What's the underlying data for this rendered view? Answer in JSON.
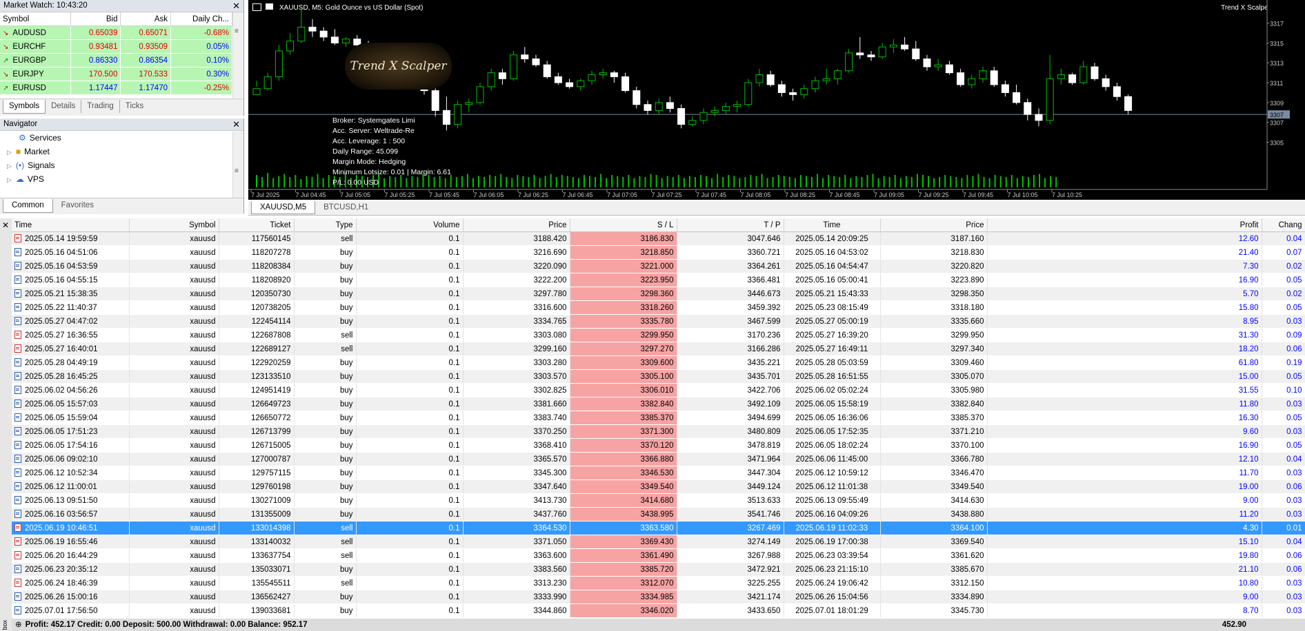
{
  "market_watch": {
    "title": "Market Watch: 10:43:20",
    "headers": [
      "Symbol",
      "Bid",
      "Ask",
      "Daily Ch..."
    ],
    "rows": [
      {
        "symbol": "AUDUSD",
        "bid": "0.65039",
        "ask": "0.65071",
        "change": "-0.68%",
        "dir": "down"
      },
      {
        "symbol": "EURCHF",
        "bid": "0.93481",
        "ask": "0.93509",
        "change": "0.05%",
        "dir": "down"
      },
      {
        "symbol": "EURGBP",
        "bid": "0.86330",
        "ask": "0.86354",
        "change": "0.10%",
        "dir": "up"
      },
      {
        "symbol": "EURJPY",
        "bid": "170.500",
        "ask": "170.533",
        "change": "0.30%",
        "dir": "down"
      },
      {
        "symbol": "EURUSD",
        "bid": "1.17447",
        "ask": "1.17470",
        "change": "-0.25%",
        "dir": "up"
      }
    ],
    "tabs": [
      "Symbols",
      "Details",
      "Trading",
      "Ticks"
    ]
  },
  "navigator": {
    "title": "Navigator",
    "items": [
      "Services",
      "Market",
      "Signals",
      "VPS"
    ],
    "tabs": [
      "Common",
      "Favorites"
    ]
  },
  "chart": {
    "title": "XAUUSD, M5:  Gold Ounce vs US Dollar (Spot)",
    "brand": "Trend X Scalper",
    "logo_text": "Trend X Scalper",
    "info": [
      "Broker:  Systemgates Limi",
      "Acc. Server:  Weltrade-Re",
      "Acc. Leverage:  1 : 500",
      "Daily Range:  45.099",
      "Margin Mode:  Hedging",
      "Minimum Lotsize: 0.01 | Margin: 6.61",
      "P/L: 0.00 USD"
    ],
    "price_labels": [
      "3317",
      "3315",
      "3313",
      "3311",
      "3309",
      "3307",
      "3305"
    ],
    "current_price_label": "3307",
    "time_labels": [
      "7 Jul 2025",
      "7 Jul 04:45",
      "7 Jul 05:05",
      "7 Jul 05:25",
      "7 Jul 05:45",
      "7 Jul 06:05",
      "7 Jul 06:25",
      "7 Jul 06:45",
      "7 Jul 07:05",
      "7 Jul 07:25",
      "7 Jul 07:45",
      "7 Jul 08:05",
      "7 Jul 08:25",
      "7 Jul 08:45",
      "7 Jul 09:05",
      "7 Jul 09:25",
      "7 Jul 09:45",
      "7 Jul 10:05",
      "7 Jul 10:25"
    ],
    "candles": [
      [
        3309.8,
        3311.2,
        3310.6,
        3310.4
      ],
      [
        3310.4,
        3312.0,
        3310.2,
        3311.6
      ],
      [
        3311.6,
        3314.8,
        3311.2,
        3314.2
      ],
      [
        3314.2,
        3316.0,
        3313.8,
        3315.2
      ],
      [
        3315.2,
        3318.6,
        3315.0,
        3316.6
      ],
      [
        3316.6,
        3317.4,
        3315.6,
        3316.2
      ],
      [
        3316.2,
        3316.6,
        3315.2,
        3315.6
      ],
      [
        3315.6,
        3316.4,
        3314.8,
        3315.0
      ],
      [
        3315.0,
        3315.6,
        3314.6,
        3315.4
      ],
      [
        3315.4,
        3315.8,
        3314.4,
        3314.8
      ],
      [
        3314.8,
        3315.2,
        3313.6,
        3313.8
      ],
      [
        3313.8,
        3314.4,
        3313.0,
        3313.4
      ],
      [
        3313.4,
        3313.8,
        3312.6,
        3312.8
      ],
      [
        3312.8,
        3313.0,
        3311.6,
        3311.8
      ],
      [
        3311.8,
        3312.4,
        3311.0,
        3311.4
      ],
      [
        3311.4,
        3311.8,
        3309.8,
        3310.2
      ],
      [
        3310.2,
        3310.6,
        3307.6,
        3308.2
      ],
      [
        3308.2,
        3309.6,
        3306.2,
        3306.8
      ],
      [
        3306.8,
        3309.2,
        3306.4,
        3308.8
      ],
      [
        3308.8,
        3309.4,
        3308.0,
        3309.0
      ],
      [
        3309.0,
        3311.0,
        3308.8,
        3310.6
      ],
      [
        3310.6,
        3312.4,
        3310.2,
        3312.0
      ],
      [
        3312.0,
        3312.4,
        3310.8,
        3311.4
      ],
      [
        3311.4,
        3314.2,
        3311.2,
        3313.8
      ],
      [
        3313.8,
        3314.6,
        3313.0,
        3313.4
      ],
      [
        3313.4,
        3313.8,
        3312.6,
        3312.8
      ],
      [
        3312.8,
        3313.2,
        3311.4,
        3311.6
      ],
      [
        3311.6,
        3312.0,
        3310.8,
        3311.0
      ],
      [
        3311.0,
        3311.4,
        3310.4,
        3310.6
      ],
      [
        3310.6,
        3311.4,
        3310.2,
        3311.2
      ],
      [
        3311.2,
        3312.2,
        3310.8,
        3311.8
      ],
      [
        3311.8,
        3312.4,
        3311.4,
        3312.0
      ],
      [
        3312.0,
        3312.2,
        3311.0,
        3311.6
      ],
      [
        3311.6,
        3312.0,
        3310.0,
        3310.2
      ],
      [
        3310.2,
        3310.6,
        3308.4,
        3308.8
      ],
      [
        3308.8,
        3309.2,
        3307.8,
        3308.2
      ],
      [
        3308.2,
        3309.4,
        3307.8,
        3309.0
      ],
      [
        3309.0,
        3309.6,
        3308.0,
        3308.4
      ],
      [
        3308.4,
        3308.8,
        3306.4,
        3306.8
      ],
      [
        3306.8,
        3307.6,
        3306.6,
        3307.2
      ],
      [
        3307.2,
        3308.4,
        3306.8,
        3308.0
      ],
      [
        3308.0,
        3308.6,
        3307.6,
        3308.2
      ],
      [
        3308.2,
        3309.0,
        3307.8,
        3308.6
      ],
      [
        3308.6,
        3309.2,
        3308.0,
        3308.8
      ],
      [
        3308.8,
        3311.4,
        3308.6,
        3311.0
      ],
      [
        3311.0,
        3312.4,
        3310.6,
        3311.8
      ],
      [
        3311.8,
        3312.2,
        3310.6,
        3310.8
      ],
      [
        3310.8,
        3311.2,
        3309.6,
        3310.0
      ],
      [
        3310.0,
        3310.4,
        3309.2,
        3309.8
      ],
      [
        3309.8,
        3310.8,
        3309.4,
        3310.4
      ],
      [
        3310.4,
        3311.6,
        3310.0,
        3311.2
      ],
      [
        3311.2,
        3312.4,
        3310.8,
        3311.4
      ],
      [
        3311.4,
        3312.4,
        3310.8,
        3312.2
      ],
      [
        3312.2,
        3314.4,
        3312.0,
        3314.0
      ],
      [
        3314.0,
        3315.6,
        3313.4,
        3313.8
      ],
      [
        3313.8,
        3314.2,
        3313.2,
        3313.6
      ],
      [
        3313.6,
        3315.0,
        3313.4,
        3314.6
      ],
      [
        3314.6,
        3315.4,
        3314.0,
        3314.8
      ],
      [
        3314.8,
        3315.6,
        3314.2,
        3314.4
      ],
      [
        3314.4,
        3315.2,
        3313.2,
        3313.4
      ],
      [
        3313.4,
        3313.8,
        3312.2,
        3312.6
      ],
      [
        3312.6,
        3313.4,
        3312.2,
        3312.8
      ],
      [
        3312.8,
        3313.2,
        3311.8,
        3312.0
      ],
      [
        3312.0,
        3312.4,
        3310.6,
        3310.8
      ],
      [
        3310.8,
        3311.8,
        3310.4,
        3311.4
      ],
      [
        3311.4,
        3312.6,
        3311.0,
        3312.2
      ],
      [
        3312.2,
        3312.6,
        3310.6,
        3310.8
      ],
      [
        3310.8,
        3311.2,
        3309.6,
        3310.0
      ],
      [
        3310.0,
        3310.8,
        3308.8,
        3309.0
      ],
      [
        3309.0,
        3309.4,
        3307.2,
        3307.8
      ],
      [
        3307.8,
        3308.4,
        3306.6,
        3307.2
      ],
      [
        3307.2,
        3313.8,
        3306.8,
        3311.4
      ],
      [
        3311.4,
        3312.4,
        3310.8,
        3311.8
      ],
      [
        3311.8,
        3312.0,
        3310.8,
        3311.0
      ],
      [
        3311.0,
        3313.2,
        3310.8,
        3312.6
      ],
      [
        3312.6,
        3313.0,
        3311.2,
        3311.4
      ],
      [
        3311.4,
        3311.8,
        3310.2,
        3310.6
      ],
      [
        3310.6,
        3311.0,
        3309.2,
        3309.6
      ],
      [
        3309.6,
        3309.8,
        3307.8,
        3308.2
      ]
    ],
    "volumes": [
      12,
      10,
      14,
      9,
      11,
      13,
      10,
      12,
      8,
      11,
      10,
      13,
      9,
      12,
      11,
      10,
      14,
      9,
      12,
      11,
      10,
      12,
      13,
      9,
      11,
      10,
      12,
      9,
      11,
      10,
      13,
      12,
      10,
      11,
      9,
      12,
      10,
      11,
      13,
      9,
      11,
      10,
      12,
      11,
      13,
      10,
      9,
      12,
      11,
      10,
      12,
      9,
      11,
      13,
      10,
      12,
      11,
      10,
      9,
      12,
      11,
      10,
      13,
      9,
      12,
      11,
      10,
      12,
      9,
      11,
      10,
      13,
      12,
      9,
      11,
      10,
      12,
      9,
      11,
      10,
      12,
      11,
      9,
      13,
      10,
      12,
      11,
      9,
      10,
      12,
      11,
      13,
      9,
      10,
      12,
      11,
      10,
      9,
      12,
      11,
      10,
      13,
      9,
      12,
      11,
      10,
      12,
      9,
      11,
      10,
      12,
      13,
      9,
      11,
      10,
      12,
      9,
      11,
      10,
      13,
      12,
      11,
      9,
      10,
      12,
      11,
      10,
      9,
      12,
      11,
      13,
      10,
      9,
      12,
      11,
      10,
      12,
      9,
      11,
      10,
      12,
      13,
      9,
      11,
      10
    ]
  },
  "chart_tabs": [
    "XAUUSD,M5",
    "BTCUSD,H1"
  ],
  "history": {
    "headers": [
      "Time",
      "Symbol",
      "Ticket",
      "Type",
      "Volume",
      "Price",
      "S / L",
      "T / P",
      "Time",
      "Price",
      "Profit",
      "Chang"
    ],
    "rows": [
      [
        "2025.05.14 19:59:59",
        "xauusd",
        "117560145",
        "sell",
        "0.1",
        "3188.420",
        "3186.830",
        "3047.646",
        "2025.05.14 20:09:25",
        "3187.160",
        "12.60",
        "0.04"
      ],
      [
        "2025.05.16 04:51:06",
        "xauusd",
        "118207278",
        "buy",
        "0.1",
        "3216.690",
        "3218.850",
        "3360.721",
        "2025.05.16 04:53:02",
        "3218.830",
        "21.40",
        "0.07"
      ],
      [
        "2025.05.16 04:53:59",
        "xauusd",
        "118208384",
        "buy",
        "0.1",
        "3220.090",
        "3221.000",
        "3364.261",
        "2025.05.16 04:54:47",
        "3220.820",
        "7.30",
        "0.02"
      ],
      [
        "2025.05.16 04:55:15",
        "xauusd",
        "118208920",
        "buy",
        "0.1",
        "3222.200",
        "3223.950",
        "3366.481",
        "2025.05.16 05:00:41",
        "3223.890",
        "16.90",
        "0.05"
      ],
      [
        "2025.05.21 15:38:35",
        "xauusd",
        "120350730",
        "buy",
        "0.1",
        "3297.780",
        "3298.360",
        "3446.673",
        "2025.05.21 15:43:33",
        "3298.350",
        "5.70",
        "0.02"
      ],
      [
        "2025.05.22 11:40:37",
        "xauusd",
        "120738205",
        "buy",
        "0.1",
        "3316.600",
        "3318.260",
        "3459.392",
        "2025.05.23 08:15:49",
        "3318.180",
        "15.80",
        "0.05"
      ],
      [
        "2025.05.27 04:47:02",
        "xauusd",
        "122454114",
        "buy",
        "0.1",
        "3334.765",
        "3335.780",
        "3467.599",
        "2025.05.27 05:00:19",
        "3335.660",
        "8.95",
        "0.03"
      ],
      [
        "2025.05.27 16:36:55",
        "xauusd",
        "122687808",
        "sell",
        "0.1",
        "3303.080",
        "3299.950",
        "3170.236",
        "2025.05.27 16:39:20",
        "3299.950",
        "31.30",
        "0.09"
      ],
      [
        "2025.05.27 16:40:01",
        "xauusd",
        "122689127",
        "sell",
        "0.1",
        "3299.160",
        "3297.270",
        "3166.286",
        "2025.05.27 16:49:11",
        "3297.340",
        "18.20",
        "0.06"
      ],
      [
        "2025.05.28 04:49:19",
        "xauusd",
        "122920259",
        "buy",
        "0.1",
        "3303.280",
        "3309.600",
        "3435.221",
        "2025.05.28 05:03:59",
        "3309.460",
        "61.80",
        "0.19"
      ],
      [
        "2025.05.28 16:45:25",
        "xauusd",
        "123133510",
        "buy",
        "0.1",
        "3303.570",
        "3305.100",
        "3435.701",
        "2025.05.28 16:51:55",
        "3305.070",
        "15.00",
        "0.05"
      ],
      [
        "2025.06.02 04:56:26",
        "xauusd",
        "124951419",
        "buy",
        "0.1",
        "3302.825",
        "3306.010",
        "3422.706",
        "2025.06.02 05:02:24",
        "3305.980",
        "31.55",
        "0.10"
      ],
      [
        "2025.06.05 15:57:03",
        "xauusd",
        "126649723",
        "buy",
        "0.1",
        "3381.660",
        "3382.840",
        "3492.109",
        "2025.06.05 15:58:19",
        "3382.840",
        "11.80",
        "0.03"
      ],
      [
        "2025.06.05 15:59:04",
        "xauusd",
        "126650772",
        "buy",
        "0.1",
        "3383.740",
        "3385.370",
        "3494.699",
        "2025.06.05 16:36:06",
        "3385.370",
        "16.30",
        "0.05"
      ],
      [
        "2025.06.05 17:51:23",
        "xauusd",
        "126713799",
        "buy",
        "0.1",
        "3370.250",
        "3371.300",
        "3480.809",
        "2025.06.05 17:52:35",
        "3371.210",
        "9.60",
        "0.03"
      ],
      [
        "2025.06.05 17:54:16",
        "xauusd",
        "126715005",
        "buy",
        "0.1",
        "3368.410",
        "3370.120",
        "3478.819",
        "2025.06.05 18:02:24",
        "3370.100",
        "16.90",
        "0.05"
      ],
      [
        "2025.06.06 09:02:10",
        "xauusd",
        "127000787",
        "buy",
        "0.1",
        "3365.570",
        "3366.880",
        "3471.964",
        "2025.06.06 11:45:00",
        "3366.780",
        "12.10",
        "0.04"
      ],
      [
        "2025.06.12 10:52:34",
        "xauusd",
        "129757115",
        "buy",
        "0.1",
        "3345.300",
        "3346.530",
        "3447.304",
        "2025.06.12 10:59:12",
        "3346.470",
        "11.70",
        "0.03"
      ],
      [
        "2025.06.12 11:00:01",
        "xauusd",
        "129760198",
        "buy",
        "0.1",
        "3347.640",
        "3349.540",
        "3449.124",
        "2025.06.12 11:01:38",
        "3349.540",
        "19.00",
        "0.06"
      ],
      [
        "2025.06.13 09:51:50",
        "xauusd",
        "130271009",
        "buy",
        "0.1",
        "3413.730",
        "3414.680",
        "3513.633",
        "2025.06.13 09:55:49",
        "3414.630",
        "9.00",
        "0.03"
      ],
      [
        "2025.06.16 03:56:57",
        "xauusd",
        "131355009",
        "buy",
        "0.1",
        "3437.760",
        "3438.995",
        "3541.746",
        "2025.06.16 04:09:26",
        "3438.880",
        "11.20",
        "0.03"
      ],
      [
        "2025.06.19 10:46:51",
        "xauusd",
        "133014398",
        "sell",
        "0.1",
        "3364.530",
        "3363.580",
        "3267.469",
        "2025.06.19 11:02:33",
        "3364.100",
        "4.30",
        "0.01"
      ],
      [
        "2025.06.19 16:55:46",
        "xauusd",
        "133140032",
        "sell",
        "0.1",
        "3371.050",
        "3369.430",
        "3274.149",
        "2025.06.19 17:00:38",
        "3369.540",
        "15.10",
        "0.04"
      ],
      [
        "2025.06.20 16:44:29",
        "xauusd",
        "133637754",
        "sell",
        "0.1",
        "3363.600",
        "3361.490",
        "3267.988",
        "2025.06.23 03:39:54",
        "3361.620",
        "19.80",
        "0.06"
      ],
      [
        "2025.06.23 20:35:12",
        "xauusd",
        "135033071",
        "buy",
        "0.1",
        "3383.560",
        "3385.720",
        "3472.921",
        "2025.06.23 21:15:10",
        "3385.670",
        "21.10",
        "0.06"
      ],
      [
        "2025.06.24 18:46:39",
        "xauusd",
        "135545511",
        "sell",
        "0.1",
        "3313.230",
        "3312.070",
        "3225.255",
        "2025.06.24 19:06:42",
        "3312.150",
        "10.80",
        "0.03"
      ],
      [
        "2025.06.26 15:00:16",
        "xauusd",
        "136562427",
        "buy",
        "0.1",
        "3333.990",
        "3334.985",
        "3421.174",
        "2025.06.26 15:04:56",
        "3334.890",
        "9.00",
        "0.03"
      ],
      [
        "2025.07.01 17:56:50",
        "xauusd",
        "139033681",
        "buy",
        "0.1",
        "3344.860",
        "3346.020",
        "3433.650",
        "2025.07.01 18:01:29",
        "3345.730",
        "8.70",
        "0.03"
      ]
    ],
    "selected_index": 21,
    "summary": "Profit: 452.17  Credit: 0.00  Deposit: 500.00  Withdrawal: 0.00  Balance: 952.17",
    "summary_profit": "452.90",
    "side_label": "box"
  },
  "colors": {
    "bull": "#00c000",
    "bear": "#ffffff",
    "sl_cell": "#f7a3a3",
    "selected": "#3399ff",
    "mw_row": "#b7f5b3"
  }
}
